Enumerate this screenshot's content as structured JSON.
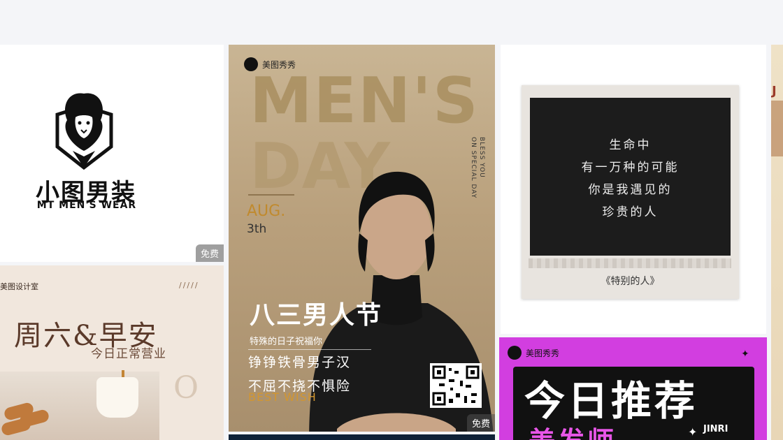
{
  "cards": {
    "logo": {
      "cn_name": "小图男装",
      "en_name": "MT MEN'S WEAR",
      "badge": "免费"
    },
    "weekend": {
      "studio": "美图设计室",
      "dots": "/////",
      "title": "周六&早安",
      "subtitle": "今日正常营业",
      "big_letter": "O"
    },
    "mensday": {
      "brand": "美图秀秀",
      "headline_1": "MEN'S",
      "headline_2": "DAY",
      "month": "AUG.",
      "day": "3th",
      "vertical_text_1": "BLESS YOU",
      "vertical_text_2": "ON SPECIAL DAY",
      "title": "八三男人节",
      "wish_1": "特殊的日子祝福你",
      "wish_2": "铮铮铁骨男子汉",
      "wish_3": "不屈不挠不惧险",
      "best_wish": "BEST WISH",
      "badge": "免费"
    },
    "polaroid": {
      "poem_1": "生命中",
      "poem_2": "有一万种的可能",
      "poem_3": "你是我遇见的",
      "poem_4": "珍贵的人",
      "caption": "《特别的人》"
    },
    "recommend": {
      "brand": "美图秀秀",
      "title": "今日推荐",
      "subtitle": "美发师",
      "tag": "JINRI"
    },
    "partial": {
      "letter": "J"
    }
  }
}
